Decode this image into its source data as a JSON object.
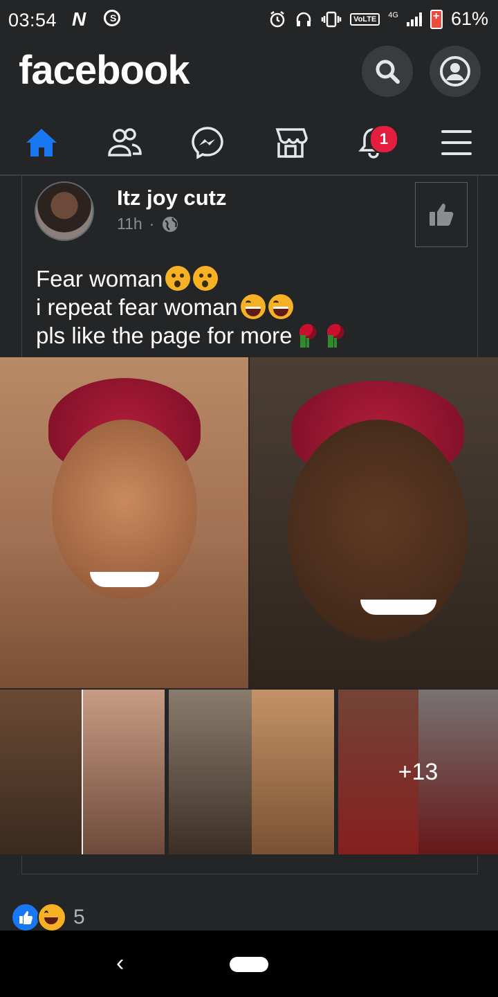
{
  "status_bar": {
    "time": "03:54",
    "n_glyph": "N",
    "ring_glyph": "S",
    "volte": "VoLTE",
    "network": "4G",
    "battery": "61%"
  },
  "header": {
    "logo": "facebook",
    "search_icon": "search-icon",
    "profile_icon": "profile-icon"
  },
  "nav": {
    "tabs": [
      "home",
      "friends",
      "messenger",
      "marketplace",
      "notifications",
      "menu"
    ],
    "notifications_badge": "1",
    "active_color": "#1877f2"
  },
  "post": {
    "author": "Itz joy cutz",
    "time": "11h",
    "separator": "·",
    "lines": [
      {
        "text": "Fear woman",
        "emoji": [
          "astonished",
          "astonished"
        ]
      },
      {
        "text": "i repeat fear woman",
        "emoji": [
          "tears-of-joy",
          "tears-of-joy"
        ]
      },
      {
        "text": "pls like the page for more",
        "emoji": [
          "rose",
          "rose"
        ]
      }
    ],
    "more_photos": "+13"
  },
  "reactions": {
    "count": "5",
    "types": [
      "like",
      "haha"
    ]
  },
  "system_nav": {
    "back_glyph": "‹"
  }
}
